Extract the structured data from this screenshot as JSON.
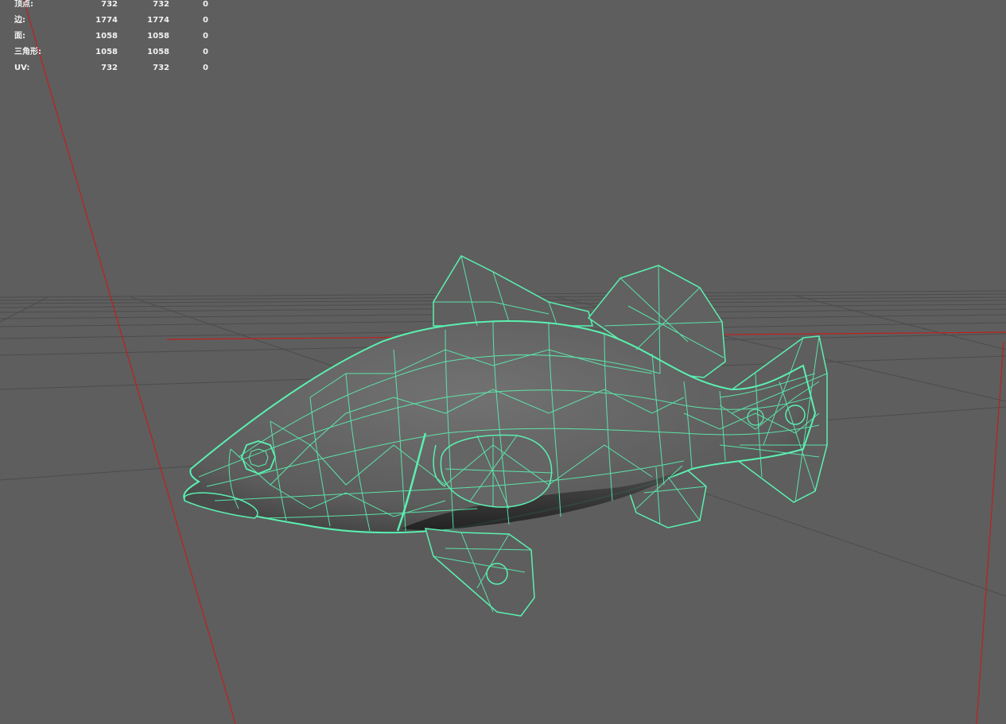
{
  "colors": {
    "background": "#5e5e5e",
    "grid": "#4a4a4a",
    "axis_red": "#c0201e",
    "wireframe": "#5bf0b0"
  },
  "hud": {
    "rows": [
      {
        "label": "顶点:",
        "c1": "732",
        "c2": "732",
        "c3": "0"
      },
      {
        "label": "边:",
        "c1": "1774",
        "c2": "1774",
        "c3": "0"
      },
      {
        "label": "面:",
        "c1": "1058",
        "c2": "1058",
        "c3": "0"
      },
      {
        "label": "三角形:",
        "c1": "1058",
        "c2": "1058",
        "c3": "0"
      },
      {
        "label": "UV:",
        "c1": "732",
        "c2": "732",
        "c3": "0"
      }
    ]
  },
  "model": {
    "icon": "fish-wireframe-mesh"
  }
}
